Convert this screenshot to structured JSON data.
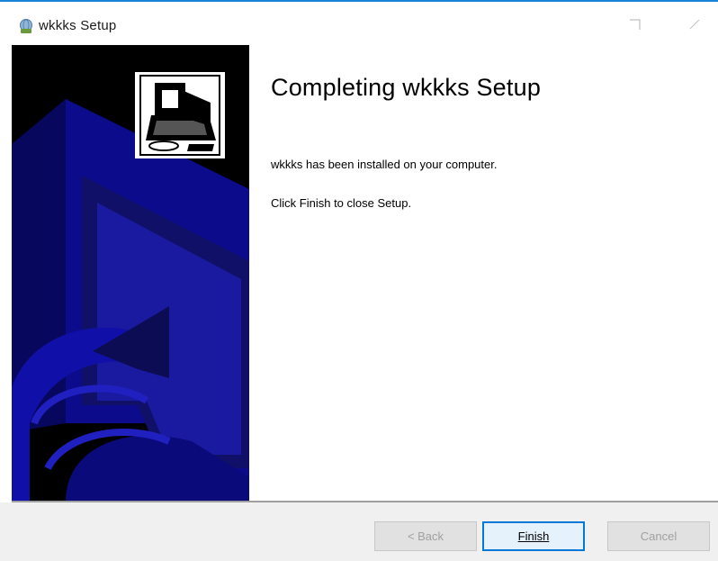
{
  "window": {
    "title": "wkkks Setup",
    "icons": {
      "app": "installer-app-icon",
      "maximize": "maximize-icon",
      "close": "close-icon"
    }
  },
  "banner": {
    "icon": "computer-install-icon",
    "accent": "#0a0a7a"
  },
  "content": {
    "heading": "Completing wkkks Setup",
    "installed_text": "wkkks has been installed on your computer.",
    "instruction_text": "Click Finish to close Setup."
  },
  "buttons": {
    "back": "< Back",
    "finish": "Finish",
    "cancel": "Cancel"
  },
  "colors": {
    "titlebar_accent": "#1883d7",
    "button_focus": "#0078d7"
  }
}
